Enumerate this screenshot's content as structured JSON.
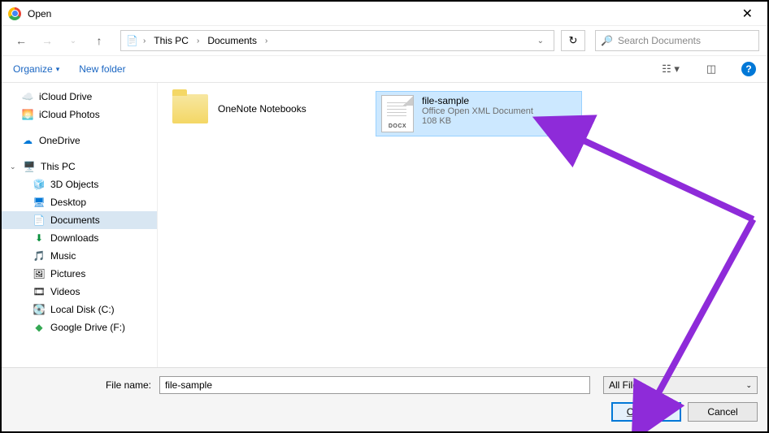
{
  "window": {
    "title": "Open"
  },
  "breadcrumb": {
    "seg1": "This PC",
    "seg2": "Documents"
  },
  "search": {
    "placeholder": "Search Documents"
  },
  "toolbar": {
    "organize": "Organize",
    "newfolder": "New folder"
  },
  "sidebar": {
    "items": [
      {
        "label": "iCloud Drive"
      },
      {
        "label": "iCloud Photos"
      },
      {
        "label": "OneDrive"
      },
      {
        "label": "This PC"
      },
      {
        "label": "3D Objects"
      },
      {
        "label": "Desktop"
      },
      {
        "label": "Documents"
      },
      {
        "label": "Downloads"
      },
      {
        "label": "Music"
      },
      {
        "label": "Pictures"
      },
      {
        "label": "Videos"
      },
      {
        "label": "Local Disk (C:)"
      },
      {
        "label": "Google Drive (F:)"
      }
    ]
  },
  "content": {
    "folder": {
      "name": "OneNote Notebooks"
    },
    "file": {
      "name": "file-sample",
      "type": "Office Open XML Document",
      "size": "108 KB",
      "ext": "DOCX"
    }
  },
  "bottom": {
    "filename_label": "File name:",
    "filename_value": "file-sample",
    "filter": "All Files",
    "open": "Open",
    "cancel": "Cancel"
  }
}
